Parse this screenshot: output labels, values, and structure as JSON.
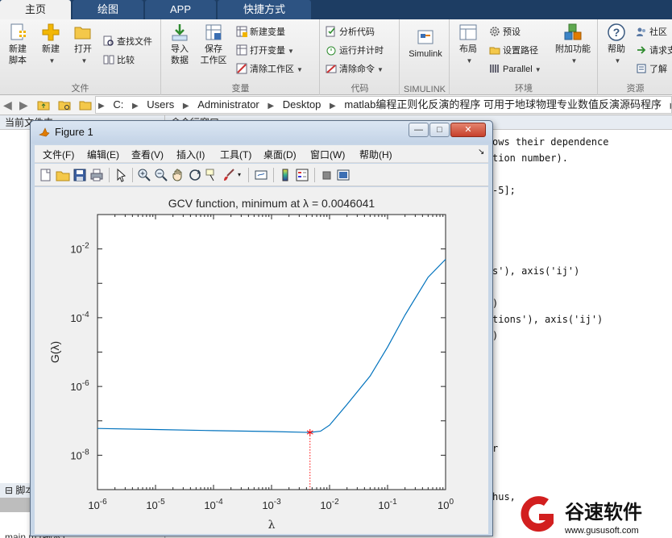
{
  "ribbon": {
    "tabs": [
      {
        "label": "主页",
        "active": true
      },
      {
        "label": "绘图",
        "active": false
      },
      {
        "label": "APP",
        "active": false
      },
      {
        "label": "快捷方式",
        "active": false
      }
    ],
    "groups": {
      "file": {
        "label": "文件",
        "new_script": "新建\n脚本",
        "new": "新建",
        "open": "打开",
        "find_files": "查找文件",
        "compare": "比较"
      },
      "variable": {
        "label": "变量",
        "import_data": "导入\n数据",
        "save_workspace": "保存\n工作区",
        "new_variable": "新建变量",
        "open_variable": "打开变量",
        "clear_workspace": "清除工作区"
      },
      "code": {
        "label": "代码",
        "analyze_code": "分析代码",
        "run_and_time": "运行并计时",
        "clear_commands": "清除命令"
      },
      "simulink": {
        "label": "SIMULINK",
        "simulink": "Simulink"
      },
      "environment": {
        "label": "环境",
        "layout": "布局",
        "preferences": "预设",
        "set_path": "设置路径",
        "parallel": "Parallel",
        "add_ons": "附加功能"
      },
      "resources": {
        "label": "资源",
        "help": "帮助",
        "community": "社区",
        "request_support": "请求支",
        "learn_more": "了解"
      }
    }
  },
  "address": {
    "crumbs": [
      "C:",
      "Users",
      "Administrator",
      "Desktop",
      "matlab编程正则化反演的程序 可用于地球物理专业数值反演源码程序",
      "code"
    ]
  },
  "left_panel": {
    "header": "当前文件夹",
    "script_header": "脚本",
    "footer_file": "main.m (脚本)"
  },
  "command_window": {
    "header": "命令行窗口",
    "lines": [
      {
        "text": "ows their dependence",
        "y": 176
      },
      {
        "text": "tion number).",
        "y": 196
      },
      {
        "text": "-5];",
        "y": 236
      },
      {
        "text": "s'), axis('ij')",
        "y": 336
      },
      {
        "text": ")",
        "y": 376
      },
      {
        "text": "tions'), axis('ij')",
        "y": 396
      },
      {
        "text": ")",
        "y": 416
      },
      {
        "text": "r",
        "y": 556
      },
      {
        "text": "hus,",
        "y": 616
      }
    ]
  },
  "figure": {
    "title": "Figure 1",
    "window_buttons": {
      "minimize": "—",
      "maximize": "□",
      "close": "✕"
    },
    "menu": [
      "文件(F)",
      "编辑(E)",
      "查看(V)",
      "插入(I)",
      "工具(T)",
      "桌面(D)",
      "窗口(W)",
      "帮助(H)"
    ],
    "toolbar_icons": [
      "new-figure-icon",
      "open-file-icon",
      "save-icon",
      "print-icon",
      "pointer-icon",
      "zoom-in-icon",
      "zoom-out-icon",
      "pan-icon",
      "rotate-icon",
      "data-cursor-icon",
      "brush-icon",
      "link-plot-icon",
      "colorbar-icon",
      "legend-icon",
      "hide-plot-tools-icon",
      "show-plot-tools-icon"
    ]
  },
  "chart_data": {
    "type": "line",
    "title": "GCV function, minimum at λ = 0.0046041",
    "xlabel": "λ",
    "ylabel": "G(λ)",
    "xscale": "log",
    "yscale": "log",
    "xlim": [
      1e-06,
      1
    ],
    "ylim": [
      1e-09,
      0.1
    ],
    "x_ticks": [
      "10^-6",
      "10^-5",
      "10^-4",
      "10^-3",
      "10^-2",
      "10^-1",
      "10^0"
    ],
    "y_ticks": [
      "10^-8",
      "10^-6",
      "10^-4",
      "10^-2"
    ],
    "grid": false,
    "series": [
      {
        "color": "#0072bd",
        "x": [
          1e-06,
          1e-05,
          0.0001,
          0.001,
          0.0046041,
          0.007,
          0.01,
          0.02,
          0.05,
          0.1,
          0.2,
          0.5,
          1
        ],
        "y": [
          6e-08,
          5.6e-08,
          5.2e-08,
          4.9e-08,
          4.6e-08,
          5e-08,
          7.5e-08,
          3e-07,
          2e-06,
          1.4e-05,
          0.00012,
          0.0015,
          0.005
        ]
      }
    ],
    "minimum_marker": {
      "x": 0.0046041,
      "y": 4.6e-08,
      "color": "#ff0000",
      "marker": "*"
    }
  }
}
